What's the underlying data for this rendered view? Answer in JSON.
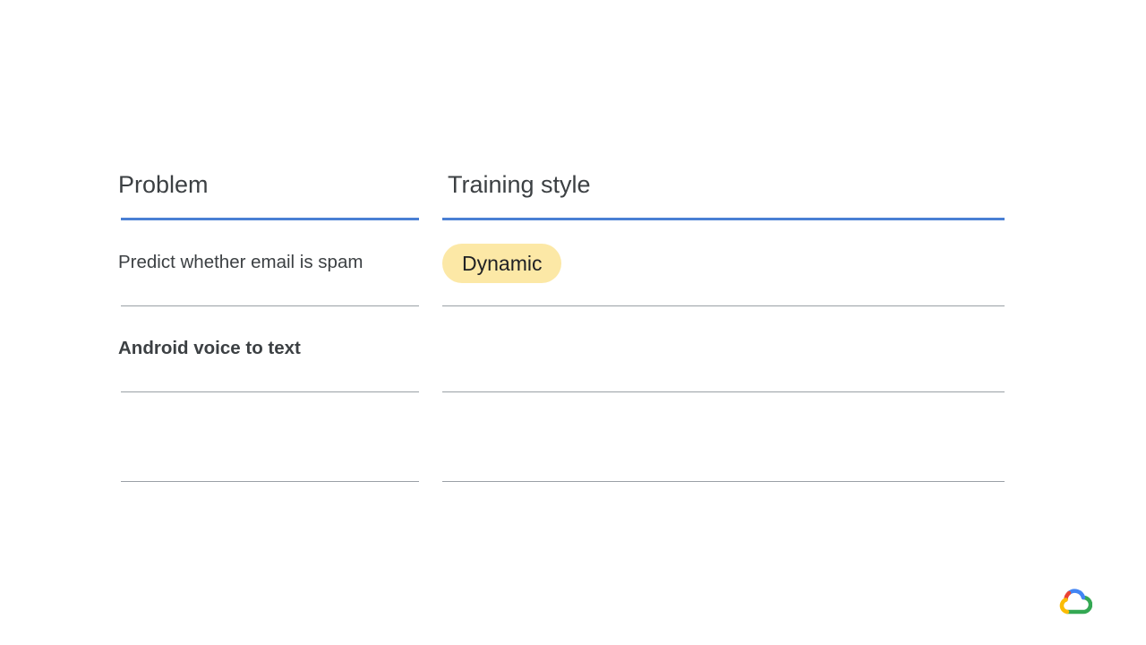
{
  "table": {
    "headers": {
      "problem": "Problem",
      "training_style": "Training style"
    },
    "rows": [
      {
        "problem": "Predict whether email is spam",
        "training_style": "Dynamic"
      },
      {
        "problem": "Android voice to text",
        "training_style": ""
      },
      {
        "problem": "",
        "training_style": ""
      }
    ]
  },
  "colors": {
    "header_rule": "#4a7fd4",
    "row_rule": "#9aa0a6",
    "chip_background": "#fce8a6",
    "text": "#3c4043"
  },
  "logo": {
    "icon": "google-cloud-icon"
  }
}
